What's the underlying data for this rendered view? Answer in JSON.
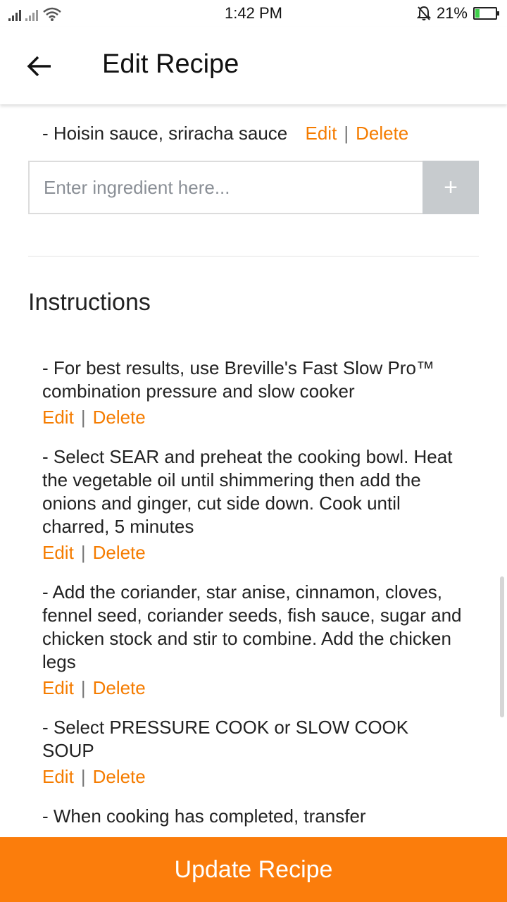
{
  "status_bar": {
    "time": "1:42 PM",
    "battery_percent": "21%",
    "battery_level": 0.21,
    "icons": [
      "signal-icon",
      "wifi-icon",
      "mute-icon",
      "battery-charging-icon"
    ]
  },
  "app_bar": {
    "title": "Edit Recipe",
    "back_icon": "arrow-left-icon"
  },
  "ingredients": {
    "last_item": "- Hoisin sauce, sriracha sauce",
    "edit_label": "Edit",
    "separator": "|",
    "delete_label": "Delete",
    "input_placeholder": "Enter ingredient here...",
    "add_button": "+"
  },
  "instructions": {
    "title": "Instructions",
    "steps": [
      {
        "text": "- For best results, use Breville's Fast Slow Pro™ combination pressure and slow cooker",
        "edit": "Edit",
        "separator": "|",
        "delete": "Delete"
      },
      {
        "text": "- Select SEAR and preheat the cooking bowl. Heat the vegetable oil until shimmering then add the onions and ginger, cut side down. Cook until charred, 5 minutes",
        "edit": "Edit",
        "separator": "|",
        "delete": "Delete"
      },
      {
        "text": "- Add the coriander, star anise, cinnamon, cloves, fennel seed, coriander seeds, fish sauce, sugar and chicken stock and stir to combine. Add the chicken legs",
        "edit": "Edit",
        "separator": "|",
        "delete": "Delete"
      },
      {
        "text": "- Select PRESSURE COOK or SLOW COOK SOUP",
        "edit": "Edit",
        "separator": "|",
        "delete": "Delete"
      },
      {
        "text": "- When cooking has completed, transfer",
        "edit": "",
        "separator": "",
        "delete": ""
      }
    ]
  },
  "footer": {
    "update_button": "Update Recipe"
  },
  "colors": {
    "accent": "#f57c00",
    "button_bg": "#fb7d0c",
    "add_button_bg": "#c7cbce"
  }
}
